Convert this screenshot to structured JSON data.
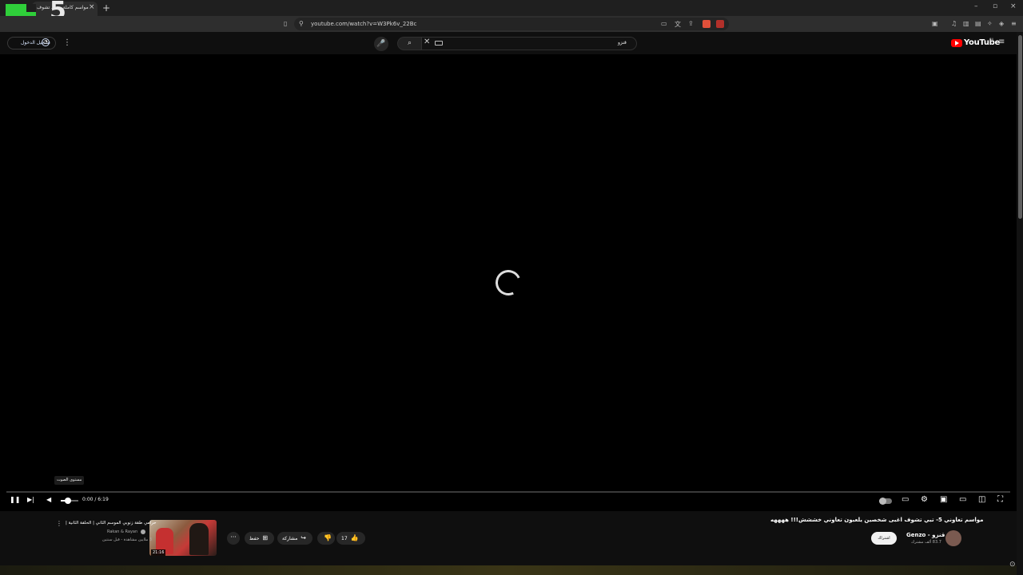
{
  "browser": {
    "tab_title": "مواسم كاملة - تبي تشوف",
    "tab_close": "×",
    "new_tab": "+",
    "url": "youtube.com/watch?v=W3Pk6v_22Bc",
    "window_controls": [
      "–",
      "▫",
      "×"
    ],
    "overlay_logo": "5"
  },
  "youtube": {
    "signin_label": "تسجيل الدخول",
    "search_query": "قنزو",
    "logo_text": "YouTube",
    "region": "SA"
  },
  "player": {
    "time": "0:00 / 6:19",
    "volume_tooltip": "مستوى الصوت",
    "volume_level": 0.35,
    "progress": 0.0
  },
  "video": {
    "title": "مواسم تعاوني 5- تبي تشوف اغبى شخصين يلعبون تعاوني خششش!!! ههههه",
    "channel": "Genzo - قنزو",
    "subscribers": "83.7 ألف مشترك",
    "subscribe_label": "اشتراك",
    "like_count": "17",
    "share_label": "مشاركة",
    "save_label": "حفظ",
    "more_label": "···"
  },
  "recommendation": {
    "title": "حرامي طقة زنوبي الموسم الثاني | الحلقة الثانية |",
    "channel": "Rakan & Rayan",
    "meta": "3 ملايين مشاهدة - قبل سنتين",
    "duration": "21:16"
  },
  "icons": {
    "pause": "❚❚",
    "next": "▶|",
    "volume": "◀",
    "captions": "▭",
    "settings": "⚙",
    "miniplayer": "▣",
    "theater": "▭",
    "cast": "◫",
    "fullscreen": "⛶",
    "like": "👍",
    "dislike": "👎",
    "share": "↪",
    "save": "⊞",
    "search": "⌕",
    "mic": "🎤",
    "clear": "✕",
    "hamburger": "≡",
    "kebab": "⋮"
  },
  "colors": {
    "youtube_red": "#ff0000",
    "logo_green": "#2fcf3a",
    "background": "#0f0f0f"
  }
}
